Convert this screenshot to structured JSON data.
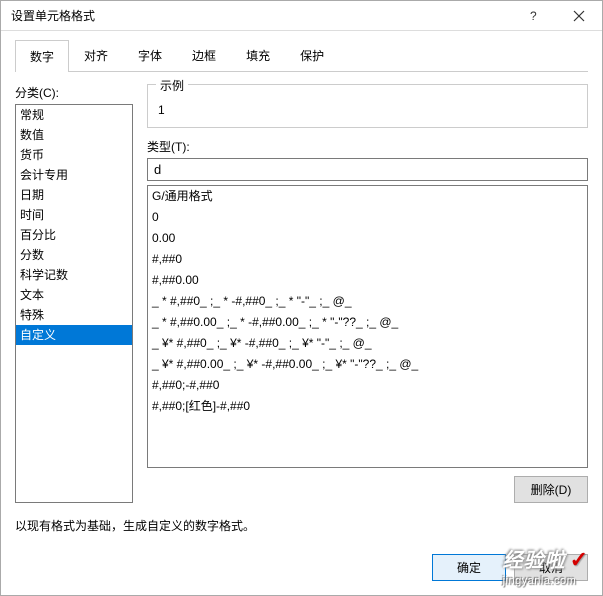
{
  "dialog": {
    "title": "设置单元格格式",
    "help_tip": "?",
    "close_tip": "×"
  },
  "tabs": [
    "数字",
    "对齐",
    "字体",
    "边框",
    "填充",
    "保护"
  ],
  "active_tab_index": 0,
  "category_label": "分类(C):",
  "categories": [
    "常规",
    "数值",
    "货币",
    "会计专用",
    "日期",
    "时间",
    "百分比",
    "分数",
    "科学记数",
    "文本",
    "特殊",
    "自定义"
  ],
  "selected_category_index": 11,
  "sample_label": "示例",
  "sample_value": "1",
  "type_label": "类型(T):",
  "type_value": "d",
  "format_options": [
    "G/通用格式",
    "0",
    "0.00",
    "#,##0",
    "#,##0.00",
    "_ * #,##0_ ;_ * -#,##0_ ;_ * \"-\"_ ;_ @_ ",
    "_ * #,##0.00_ ;_ * -#,##0.00_ ;_ * \"-\"??_ ;_ @_ ",
    "_ ¥* #,##0_ ;_ ¥* -#,##0_ ;_ ¥* \"-\"_ ;_ @_ ",
    "_ ¥* #,##0.00_ ;_ ¥* -#,##0.00_ ;_ ¥* \"-\"??_ ;_ @_ ",
    "#,##0;-#,##0",
    "#,##0;[红色]-#,##0"
  ],
  "delete_btn": "删除(D)",
  "description": "以现有格式为基础，生成自定义的数字格式。",
  "ok_btn": "确定",
  "cancel_btn": "取消",
  "watermark": {
    "brand": "经验啦",
    "url": "jingyanla.com"
  }
}
